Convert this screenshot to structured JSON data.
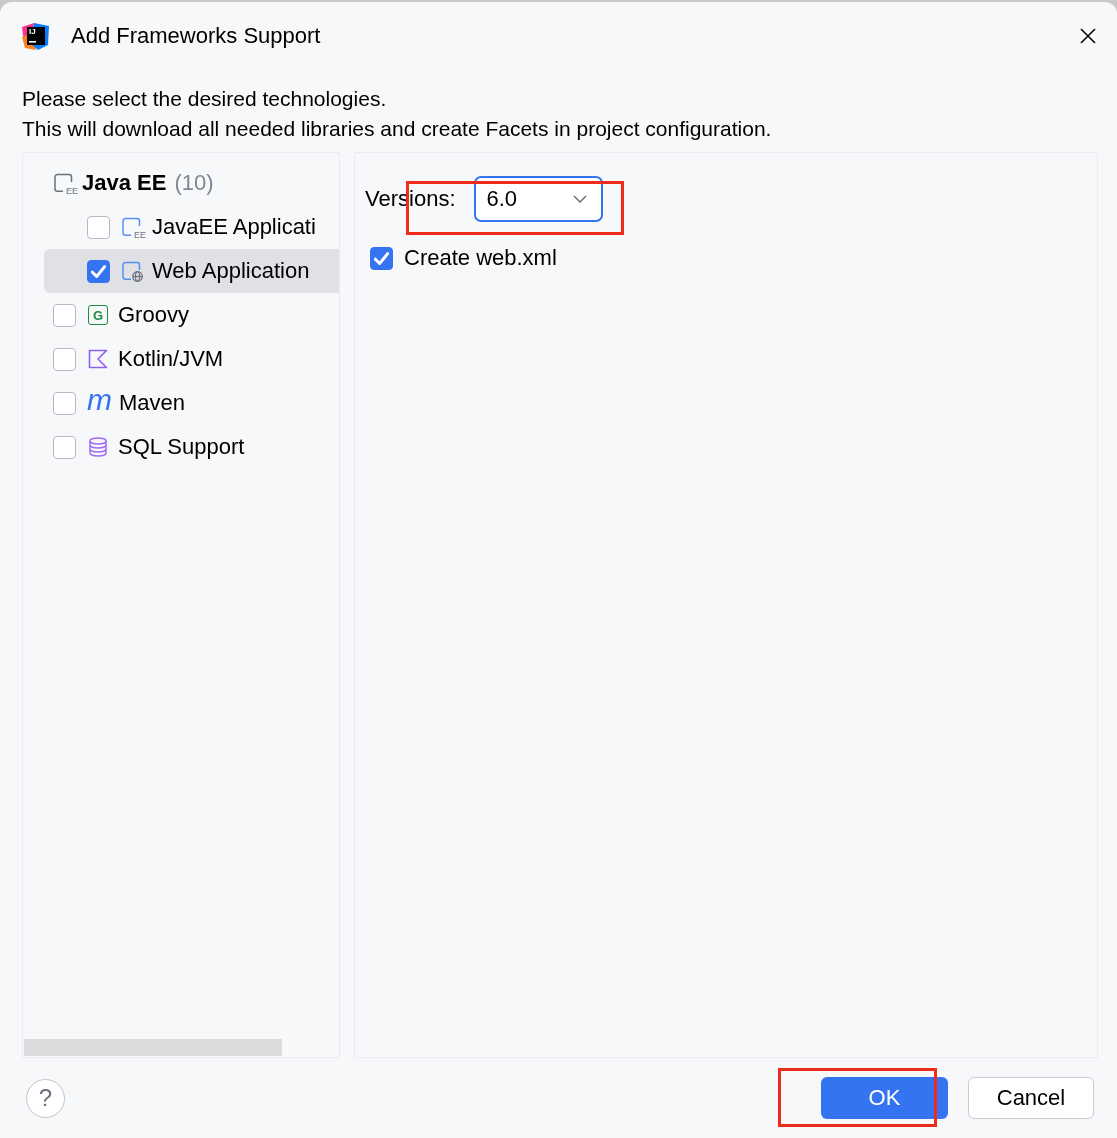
{
  "window": {
    "title": "Add Frameworks Support",
    "logo_text": "IJ"
  },
  "description": [
    "Please select the desired technologies.",
    "This will download all needed libraries and create Facets in project configuration."
  ],
  "frameworks": [
    {
      "kind": "group",
      "label": "Java EE",
      "count": "(10)",
      "icon_text": "EE",
      "selected": false,
      "children": [
        {
          "kind": "javaee",
          "label": "JavaEE Applicati",
          "icon_text": "EE",
          "checked": false,
          "selected": false
        },
        {
          "kind": "web",
          "label": "Web Application",
          "checked": true,
          "selected": true
        }
      ]
    },
    {
      "kind": "groovy",
      "label": "Groovy",
      "icon_text": "G",
      "checked": false,
      "selected": false
    },
    {
      "kind": "kotlin",
      "label": "Kotlin/JVM",
      "checked": false,
      "selected": false
    },
    {
      "kind": "maven",
      "label": "Maven",
      "icon_text": "m",
      "checked": false,
      "selected": false
    },
    {
      "kind": "sql",
      "label": "SQL Support",
      "checked": false,
      "selected": false
    }
  ],
  "settings": {
    "versions": {
      "label": "Versions:",
      "value": "6.0",
      "focused": true,
      "highlighted": true
    },
    "create_web_xml": {
      "label": "Create web.xml",
      "checked": true
    }
  },
  "buttons": [
    {
      "kind": "help",
      "label": "?"
    },
    {
      "kind": "primary",
      "label": "OK",
      "highlighted": true
    },
    {
      "kind": "secondary",
      "label": "Cancel"
    }
  ]
}
